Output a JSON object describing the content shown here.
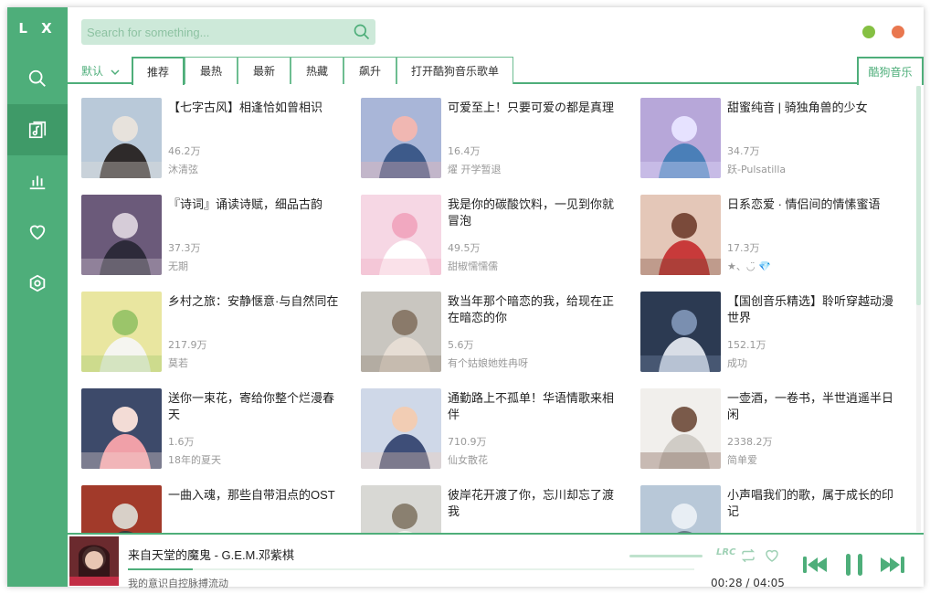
{
  "app": {
    "logo": "L X"
  },
  "colors": {
    "accent": "#4eae7a",
    "accent_dark": "#3f9a68",
    "light": "#cde9d9",
    "min_btn": "#85c043",
    "close_btn": "#e9774f"
  },
  "sidebar": {
    "items": [
      {
        "name": "search-icon"
      },
      {
        "name": "music-note-icon",
        "active": true
      },
      {
        "name": "chart-icon"
      },
      {
        "name": "heart-icon"
      },
      {
        "name": "settings-icon"
      }
    ]
  },
  "search": {
    "placeholder": "Search for something..."
  },
  "tabs": {
    "sort_label": "默认",
    "items": [
      "推荐",
      "最热",
      "最新",
      "热藏",
      "飙升",
      "打开酷狗音乐歌单"
    ],
    "source_label": "酷狗音乐"
  },
  "playlists": [
    {
      "title": "【七字古风】相逢恰如曾相识",
      "plays": "46.2万",
      "author": "沐清弦"
    },
    {
      "title": "可爱至上！只要可爱の都是真理",
      "plays": "16.4万",
      "author": "燿 开学暂退"
    },
    {
      "title": "甜蜜纯音 | 骑独角兽的少女",
      "plays": "34.7万",
      "author": "跃-Pulsatilla"
    },
    {
      "title": "『诗词』诵读诗赋，细品古韵",
      "plays": "37.3万",
      "author": "无期"
    },
    {
      "title": "我是你的碳酸饮料，一见到你就冒泡",
      "plays": "49.5万",
      "author": "甜椒懦懦儒"
    },
    {
      "title": "日系恋爱 · 情侣间的情愫蜜语",
      "plays": "17.3万",
      "author": "★、◡̈ 💎"
    },
    {
      "title": "乡村之旅：安静惬意·与自然同在",
      "plays": "217.9万",
      "author": "莫若"
    },
    {
      "title": "致当年那个暗恋的我，给现在正在暗恋的你",
      "plays": "5.6万",
      "author": "有个姑娘她姓冉呀"
    },
    {
      "title": "【国创音乐精选】聆听穿越动漫世界",
      "plays": "152.1万",
      "author": "成功"
    },
    {
      "title": "送你一束花，寄给你整个烂漫春天",
      "plays": "1.6万",
      "author": "18年的夏天"
    },
    {
      "title": "通勤路上不孤单！华语情歌来相伴",
      "plays": "710.9万",
      "author": "仙女散花"
    },
    {
      "title": "一壶酒，一卷书，半世逍遥半日闲",
      "plays": "2338.2万",
      "author": "简单爱"
    },
    {
      "title": "一曲入魂，那些自带泪点的OST",
      "plays": "",
      "author": ""
    },
    {
      "title": "彼岸花开渡了你，忘川却忘了渡我",
      "plays": "",
      "author": ""
    },
    {
      "title": "小声唱我们的歌，属于成长的印记",
      "plays": "",
      "author": ""
    }
  ],
  "player": {
    "title": "来自天堂的魔鬼 - G.E.M.邓紫棋",
    "lyric": "我的意识自控脉搏流动",
    "current_time": "00:28",
    "separator": "/",
    "total_time": "04:05",
    "progress": 0.114,
    "lrc_label": "LRC"
  }
}
